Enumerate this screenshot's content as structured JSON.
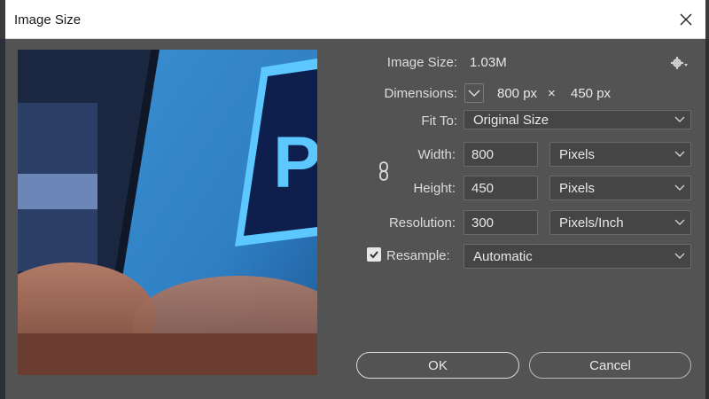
{
  "window": {
    "title": "Image Size"
  },
  "image_size": {
    "label": "Image Size:",
    "value": "1.03M"
  },
  "dimensions": {
    "label": "Dimensions:",
    "width_value": "800",
    "width_unit": "px",
    "times": "×",
    "height_value": "450",
    "height_unit": "px"
  },
  "fit_to": {
    "label": "Fit To:",
    "value": "Original Size"
  },
  "width": {
    "label": "Width:",
    "value": "800",
    "unit": "Pixels"
  },
  "height": {
    "label": "Height:",
    "value": "450",
    "unit": "Pixels"
  },
  "resolution": {
    "label": "Resolution:",
    "value": "300",
    "unit": "Pixels/Inch"
  },
  "resample": {
    "label": "Resample:",
    "checked": true,
    "value": "Automatic"
  },
  "buttons": {
    "ok": "OK",
    "cancel": "Cancel"
  },
  "preview": {
    "logo_letter": "P"
  },
  "colors": {
    "dialog_bg": "#535353",
    "field_bg": "#454545",
    "titlebar_bg": "#ffffff"
  },
  "icons": [
    "close-icon",
    "gear-icon",
    "chevron-down-icon",
    "link-chain-icon",
    "checkmark-icon"
  ]
}
